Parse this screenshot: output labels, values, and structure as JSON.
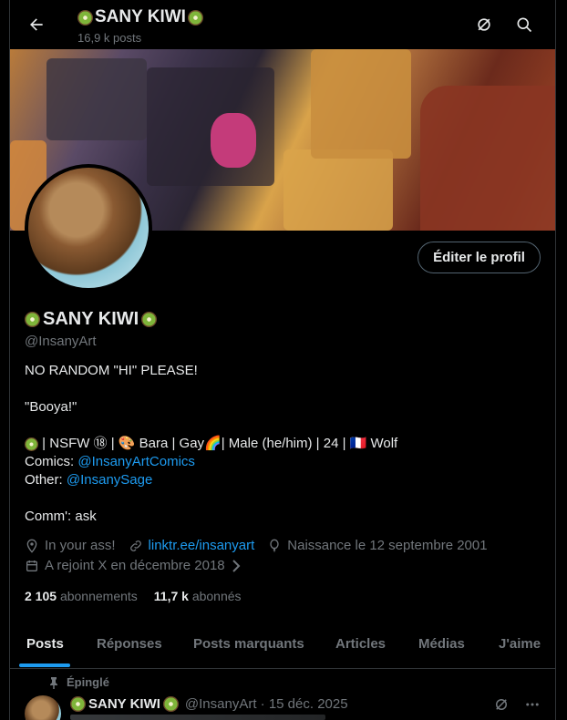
{
  "header": {
    "title": "SANY KIWI",
    "posts_count": "16,9 k posts"
  },
  "profile": {
    "edit_button": "Éditer le profil",
    "name": "SANY KIWI",
    "handle": "@InsanyArt",
    "bio": {
      "line1": "NO RANDOM \"HI\" PLEASE!",
      "line2": "\"Booya!\"",
      "line3": " | NSFW ⑱ | 🎨 Bara | Gay🌈| Male (he/him) | 24 | 🇫🇷 Wolf",
      "comics_label": "Comics: ",
      "comics_link": "@InsanyArtComics",
      "other_label": "Other: ",
      "other_link": "@InsanySage",
      "comm": "Comm': ask"
    },
    "location": "In your ass!",
    "website": "linktr.ee/insanyart",
    "birthday": "Naissance le 12 septembre 2001",
    "joined": "A rejoint X en décembre 2018",
    "following_count": "2 105",
    "following_label": "abonnements",
    "followers_count": "11,7 k",
    "followers_label": "abonnés"
  },
  "tabs": [
    "Posts",
    "Réponses",
    "Posts marquants",
    "Articles",
    "Médias",
    "J'aime"
  ],
  "pinned_post": {
    "pinned_label": "Épinglé",
    "author": "SANY KIWI",
    "handle_date": "@InsanyArt · 15 déc. 2025"
  },
  "colors": {
    "accent": "#1d9bf0",
    "muted": "#71767b",
    "text": "#e7e9ea",
    "bg": "#000000"
  },
  "icons": [
    "back-arrow-icon",
    "grok-icon",
    "search-icon",
    "location-icon",
    "link-icon",
    "balloon-icon",
    "calendar-icon",
    "pin-icon",
    "more-icon"
  ]
}
